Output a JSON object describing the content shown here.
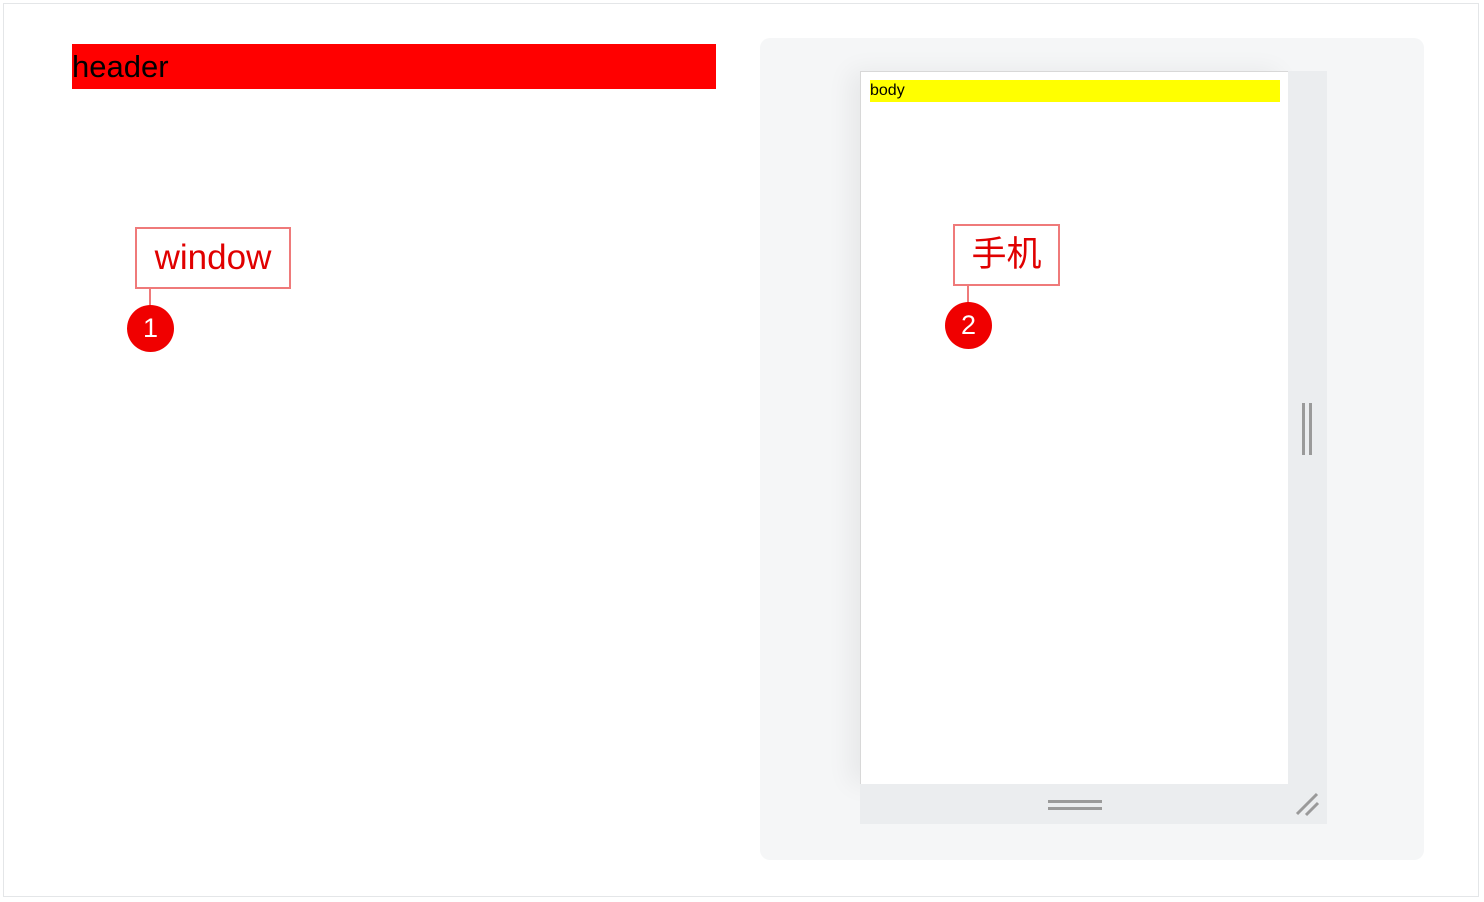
{
  "left_demo": {
    "header_label": "header",
    "callout_label": "window",
    "marker_number": "1"
  },
  "preview": {
    "body_label": "body",
    "callout_label": "手机",
    "marker_number": "2"
  },
  "colors": {
    "header_fill": "#ff0000",
    "body_fill": "#ffff00",
    "callout_red": "#e00000",
    "marker_red": "#f00000",
    "panel_bg": "#f5f6f7",
    "handle_bg": "#ebedef"
  }
}
